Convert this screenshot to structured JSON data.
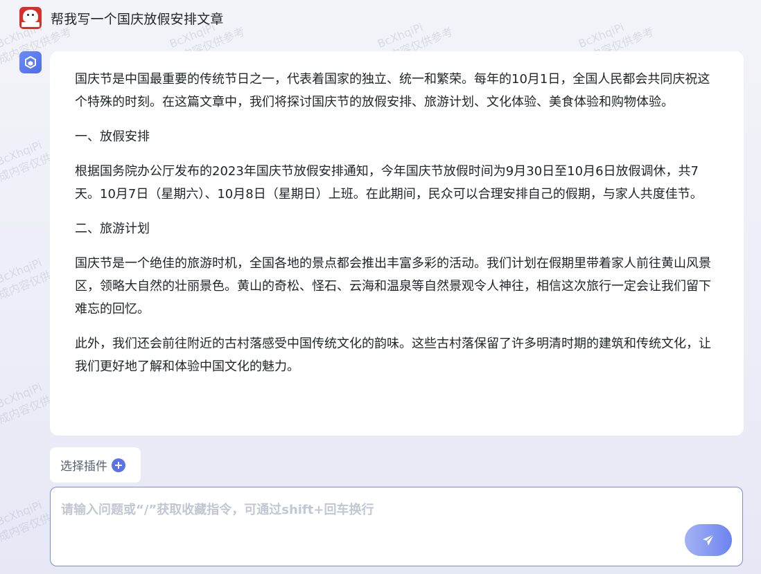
{
  "conversation": {
    "user_question": "帮我写一个国庆放假安排文章",
    "answer_paragraphs": [
      "国庆节是中国最重要的传统节日之一，代表着国家的独立、统一和繁荣。每年的10月1日，全国人民都会共同庆祝这个特殊的时刻。在这篇文章中，我们将探讨国庆节的放假安排、旅游计划、文化体验、美食体验和购物体验。",
      "一、放假安排",
      "根据国务院办公厅发布的2023年国庆节放假安排通知，今年国庆节放假时间为9月30日至10月6日放假调休，共7天。10月7日（星期六）、10月8日（星期日）上班。在此期间，民众可以合理安排自己的假期，与家人共度佳节。",
      "二、旅游计划",
      "国庆节是一个绝佳的旅游时机，全国各地的景点都会推出丰富多彩的活动。我们计划在假期里带着家人前往黄山风景区，领略大自然的壮丽景色。黄山的奇松、怪石、云海和温泉等自然景观令人神往，相信这次旅行一定会让我们留下难忘的回忆。",
      "此外，我们还会前往附近的古村落感受中国传统文化的韵味。这些古村落保留了许多明清时期的建筑和传统文化，让我们更好地了解和体验中国文化的魅力。"
    ]
  },
  "plugin": {
    "label": "选择插件",
    "icon": "plus-circle-icon"
  },
  "input": {
    "placeholder": "请输入问题或“/”获取收藏指令，可通过shift+回车换行",
    "value": ""
  },
  "send": {
    "icon": "paper-plane-icon"
  },
  "watermark": {
    "line1": "BcXhqiPi",
    "line2": "AI生成内容仅供参考"
  },
  "colors": {
    "accent": "#5b73e8",
    "user_avatar": "#d6302a",
    "bot_avatar": "#5a7bef",
    "input_border": "#7b88e6"
  }
}
